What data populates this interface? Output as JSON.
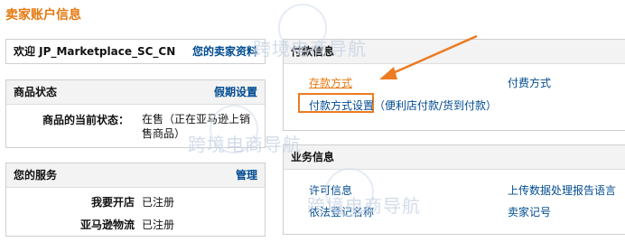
{
  "page_title": "卖家账户信息",
  "welcome": {
    "text": "欢迎 JP_Marketplace_SC_CN",
    "profile_link": "您的卖家资料"
  },
  "product_status": {
    "title": "商品状态",
    "vacation_link": "假期设置",
    "current_status_label": "商品的当前状态：",
    "current_status_value": "在售（正在亚马逊上销售商品）"
  },
  "services": {
    "title": "您的服务",
    "manage_link": "管理",
    "rows": [
      {
        "label": "我要开店",
        "value": "已注册"
      },
      {
        "label": "亚马逊物流",
        "value": "已注册"
      }
    ]
  },
  "payment": {
    "title": "付款信息",
    "deposit_link": "存款方式",
    "charge_link": "付费方式",
    "settings_link": "付款方式设置（便利店付款/货到付款）",
    "highlight_color": "#ec7b22"
  },
  "business": {
    "title": "业务信息",
    "license_link": "许可信息",
    "report_lang_link": "上传数据处理报告语言",
    "registered_name_link": "依法登记名称",
    "seller_record_link": "卖家记号"
  },
  "watermark": {
    "text": "跨境电商导航"
  }
}
